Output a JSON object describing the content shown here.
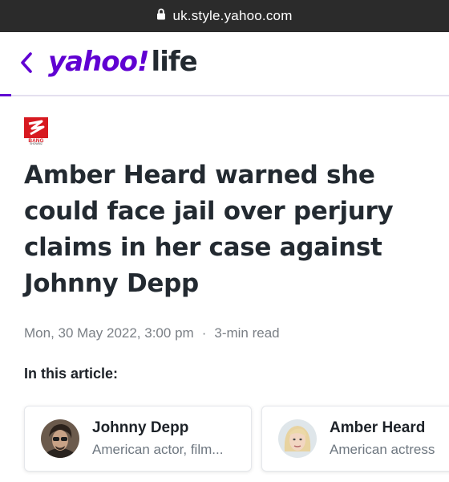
{
  "browser": {
    "url": "uk.style.yahoo.com",
    "lock_icon": "lock-icon"
  },
  "header": {
    "back_icon": "chevron-left-icon",
    "logo_primary": "yahoo!",
    "logo_secondary": "life",
    "brand_color": "#6001d2"
  },
  "article": {
    "publisher_logo_text": "BANG SHOWBIZ",
    "publisher_color": "#d71920",
    "title": "Amber Heard warned she could face jail over perjury claims in her case against Johnny Depp",
    "date": "Mon, 30 May 2022, 3:00 pm",
    "separator": "·",
    "read_time": "3-min read",
    "in_this_article_label": "In this article:"
  },
  "entities": [
    {
      "name": "Johnny Depp",
      "description": "American actor, film..."
    },
    {
      "name": "Amber Heard",
      "description": "American actress"
    }
  ]
}
